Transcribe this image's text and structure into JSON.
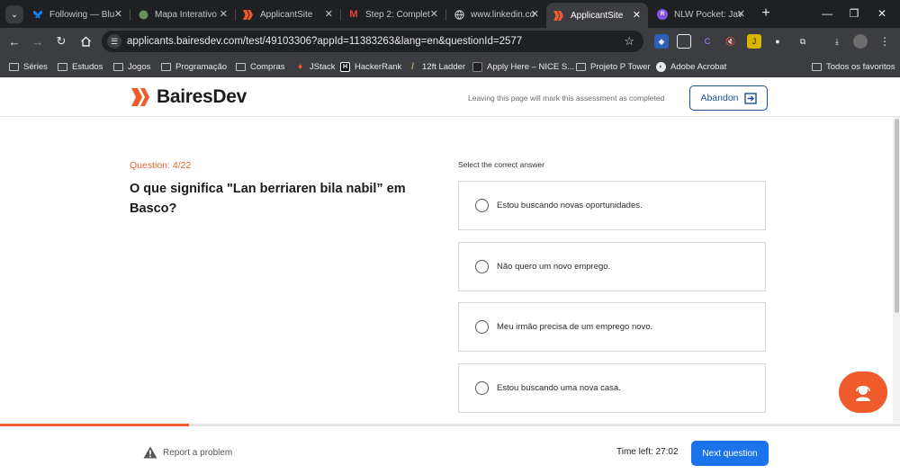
{
  "browser": {
    "tabs": [
      {
        "title": "Following — Blu",
        "icon": "butterfly-icon",
        "color": "#1185fe"
      },
      {
        "title": "Mapa Interativo",
        "icon": "globe-icon",
        "color": "#9aa0a6"
      },
      {
        "title": "ApplicantSite",
        "icon": "bairesdev-icon",
        "color": "#ef5b2b"
      },
      {
        "title": "Step 2: Complet",
        "icon": "gmail-icon",
        "color": "#ea4335"
      },
      {
        "title": "www.linkedin.co",
        "icon": "globe-icon",
        "color": "#9aa0a6"
      },
      {
        "title": "ApplicantSite",
        "icon": "bairesdev-icon",
        "color": "#ef5b2b",
        "active": true
      },
      {
        "title": "NLW Pocket: Jav",
        "icon": "rocketseat-icon",
        "color": "#8257e5"
      }
    ],
    "url": "applicants.bairesdev.com/test/49103306?appId=11383263&lang=en&questionId=2577",
    "bookmarks": [
      {
        "label": "Séries",
        "icon": "folder-icon"
      },
      {
        "label": "Estudos",
        "icon": "folder-icon"
      },
      {
        "label": "Jogos",
        "icon": "folder-icon"
      },
      {
        "label": "Programação",
        "icon": "folder-icon"
      },
      {
        "label": "Compras",
        "icon": "folder-icon"
      },
      {
        "label": "JStack",
        "icon": "jstack-icon"
      },
      {
        "label": "HackerRank",
        "icon": "hackerrank-icon"
      },
      {
        "label": "12ft Ladder",
        "icon": "ladder-icon"
      },
      {
        "label": "Apply Here – NICE S...",
        "icon": "nice-icon"
      },
      {
        "label": "Projeto P Tower",
        "icon": "folder-icon"
      },
      {
        "label": "Adobe Acrobat",
        "icon": "adobe-icon"
      }
    ],
    "all_favorites": "Todos os favoritos"
  },
  "header": {
    "brand": "BairesDev",
    "leaving_notice": "Leaving this page will mark this assessment as completed",
    "abandon_label": "Abandon"
  },
  "question": {
    "number": "Question: 4/22",
    "text": "O que significa \"Lan berriaren bila nabil” em Basco?",
    "select_label": "Select the correct answer",
    "options": [
      "Estou buscando novas oportunidades.",
      "Não quero um novo emprego.",
      "Meu irmão precisa de um emprego novo.",
      "Estou buscando uma nova casa."
    ]
  },
  "footer": {
    "report_label": "Report a problem",
    "time_left": "Time left: 27:02",
    "next_label": "Next question",
    "progress_fraction": 0.21
  },
  "colors": {
    "accent": "#ef5b2b",
    "primary_button": "#1a73e8",
    "abandon_border": "#1d4f8f"
  }
}
